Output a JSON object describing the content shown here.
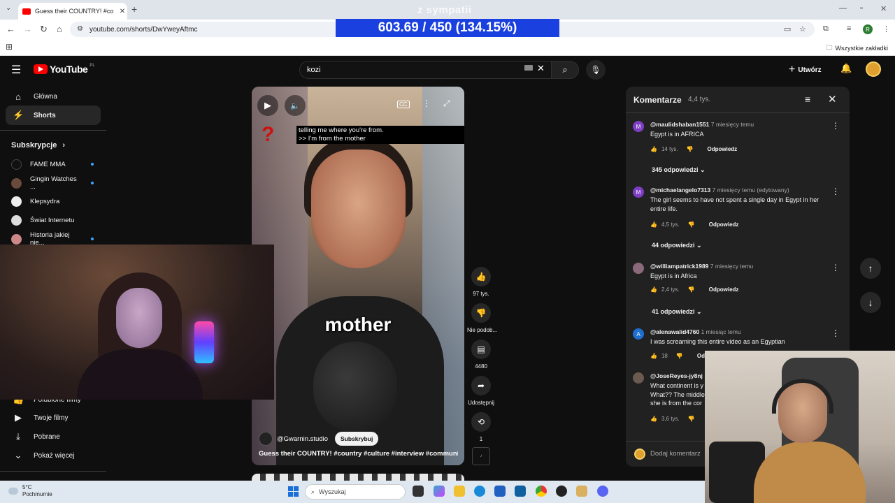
{
  "browser": {
    "tab_title": "Guess their COUNTRY! #country",
    "url": "youtube.com/shorts/DwYweyAftmc",
    "all_bookmarks": "Wszystkie zakładki",
    "profile_initial": "R"
  },
  "overlay": {
    "top_text": "z sympatii",
    "counter": "603.69 / 450 (134.15%)"
  },
  "header": {
    "logo_text": "YouTube",
    "logo_country": "PL",
    "search_value": "kozi",
    "create_label": "Utwórz"
  },
  "sidebar": {
    "items": [
      {
        "label": "Główna",
        "icon": "home-icon"
      },
      {
        "label": "Shorts",
        "icon": "shorts-icon"
      }
    ],
    "subscriptions_title": "Subskrypcje",
    "subscriptions": [
      {
        "label": "FAME MMA",
        "new": true
      },
      {
        "label": "Gingin Watches ...",
        "new": true
      },
      {
        "label": "Klepsydra",
        "new": false
      },
      {
        "label": "Świat Internetu",
        "new": false
      },
      {
        "label": "Historia jakiej nie...",
        "new": true
      }
    ],
    "bottom_items": [
      {
        "label": "Polubione filmy",
        "icon": "like-icon"
      },
      {
        "label": "Twoje filmy",
        "icon": "video-icon"
      },
      {
        "label": "Pobrane",
        "icon": "download-icon"
      },
      {
        "label": "Pokaż więcej",
        "icon": "chevron-down-icon"
      }
    ]
  },
  "video": {
    "caption_line1": "telling me where you're from.",
    "caption_line2": ">> I'm from the mother",
    "big_word": "mother",
    "channel": "@Gwarnin.studio",
    "subscribe_label": "Subskrybuj",
    "title": "Guess their COUNTRY! #country #culture #interview #community ..."
  },
  "actions": {
    "likes": "97 tys.",
    "dislike_label": "Nie podob...",
    "comments": "4480",
    "share_label": "Udostępnij",
    "remix_count": "1"
  },
  "comments": {
    "title": "Komentarze",
    "count": "4,4 tys.",
    "add_placeholder": "Dodaj komentarz",
    "reply_label": "Odpowiedz",
    "list": [
      {
        "author": "@maulidshaban1551",
        "time": "7 miesięcy temu",
        "text": "Egypt is in AFRICA",
        "likes": "14 tys.",
        "replies": "345 odpowiedzi",
        "initial": "M",
        "color": "#7e3ec4"
      },
      {
        "author": "@michaelangelo7313",
        "time": "7 miesięcy temu (edytowany)",
        "text": "The girl seems to have not spent a single day in Egypt in her entire life.",
        "likes": "4,5 tys.",
        "replies": "44 odpowiedzi",
        "initial": "M",
        "color": "#7e3ec4"
      },
      {
        "author": "@williampatrick1989",
        "time": "7 miesięcy temu",
        "text": "Egypt is in Africa",
        "likes": "2,4 tys.",
        "replies": "41 odpowiedzi",
        "initial": "",
        "color": "#8a6a7a"
      },
      {
        "author": "@alenawalid4760",
        "time": "1 miesiąc temu",
        "text": "I was screaming this entire video as an Egyptian",
        "likes": "18",
        "replies": "",
        "initial": "A",
        "color": "#1e6fd0"
      },
      {
        "author": "@JoseReyes-jy8nj",
        "time": "",
        "text": "What continent is y\nWhat?? The middle\nshe is from the cor",
        "likes": "3,6 tys.",
        "replies": "",
        "initial": "",
        "color": "#6a5a50"
      }
    ]
  },
  "taskbar": {
    "temperature": "5°C",
    "weather": "Pochmurnie",
    "search": "Wyszukaj"
  }
}
